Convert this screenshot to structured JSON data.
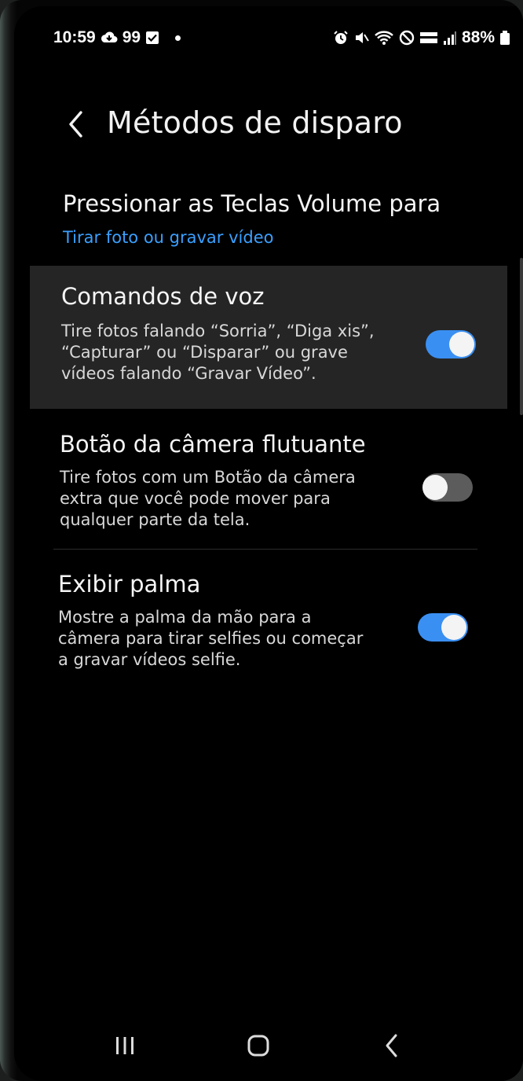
{
  "status_bar": {
    "time": "10:59",
    "notification_count": "99",
    "battery": "88%"
  },
  "header": {
    "title": "Métodos de disparo"
  },
  "settings": [
    {
      "title": "Pressionar as Teclas Volume para",
      "value": "Tirar foto ou gravar vídeo"
    },
    {
      "title": "Comandos de voz",
      "description": "Tire fotos falando “Sorria”, “Diga xis”,\n“Capturar” ou “Disparar” ou grave\nvídeos falando “Gravar Vídeo”.",
      "enabled": true
    },
    {
      "title": "Botão da câmera flutuante",
      "description": "Tire fotos com um Botão da câmera\nextra que você pode mover para\nqualquer parte da tela.",
      "enabled": false
    },
    {
      "title": "Exibir palma",
      "description": "Mostre a palma da mão para a\ncâmera para tirar selfies ou começar\na gravar vídeos selfie.",
      "enabled": true
    }
  ],
  "colors": {
    "accent": "#3aa0ff",
    "toggle_on": "#3a8ff2",
    "toggle_off": "#5c5c5c",
    "background": "#000000"
  },
  "icons": {
    "status_left": [
      "cloud-icon",
      "checkbox-icon"
    ],
    "status_right": [
      "alarm-icon",
      "mute-icon",
      "wifi-icon",
      "blocked-icon",
      "volte-icon",
      "signal-icon",
      "battery-icon"
    ],
    "nav": [
      "recent-apps-icon",
      "home-icon",
      "back-icon"
    ]
  }
}
